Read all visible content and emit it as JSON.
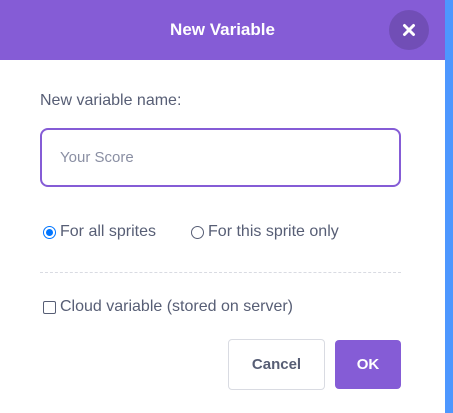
{
  "dialog": {
    "title": "New Variable",
    "close_icon": "close-icon"
  },
  "form": {
    "name_label": "New variable name:",
    "name_input": {
      "value": "",
      "placeholder": "Your Score"
    },
    "scope_options": [
      {
        "label": "For all sprites",
        "selected": true
      },
      {
        "label": "For this sprite only",
        "selected": false
      }
    ],
    "cloud_option": {
      "label": "Cloud variable (stored on server)",
      "checked": false
    }
  },
  "buttons": {
    "cancel_label": "Cancel",
    "ok_label": "OK"
  },
  "colors": {
    "accent": "#855cd6",
    "text": "#575e75",
    "radio_selected": "#0075ff",
    "side_strip": "#4d97ff"
  }
}
